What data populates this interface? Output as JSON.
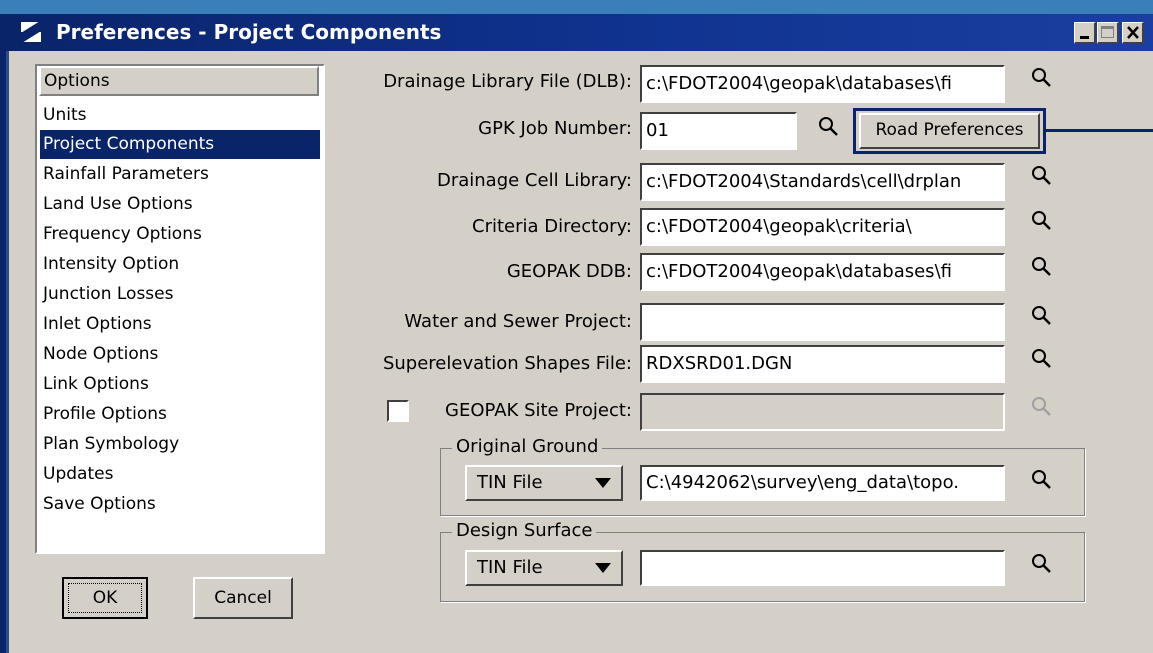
{
  "window": {
    "title": "Preferences - Project Components",
    "minimize_glyph": "_",
    "maximize_glyph": "□",
    "close_glyph": "✕"
  },
  "options_list": {
    "header": "Options",
    "items": [
      "Units",
      "Project Components",
      "Rainfall Parameters",
      "Land Use Options",
      "Frequency Options",
      "Intensity Option",
      "Junction Losses",
      "Inlet Options",
      "Node Options",
      "Link Options",
      "Profile Options",
      "Plan Symbology",
      "Updates",
      "Save Options"
    ],
    "selected": "Project Components"
  },
  "buttons": {
    "ok": "OK",
    "cancel": "Cancel",
    "road_preferences": "Road Preferences"
  },
  "fields": {
    "drainage_library": {
      "label": "Drainage Library File (DLB):",
      "value": "c:\\FDOT2004\\geopak\\databases\\fi"
    },
    "gpk_job": {
      "label": "GPK Job Number:",
      "value": "01"
    },
    "drainage_cell": {
      "label": "Drainage Cell Library:",
      "value": "c:\\FDOT2004\\Standards\\cell\\drplan"
    },
    "criteria_dir": {
      "label": "Criteria Directory:",
      "value": "c:\\FDOT2004\\geopak\\criteria\\"
    },
    "geopak_ddb": {
      "label": "GEOPAK DDB:",
      "value": "c:\\FDOT2004\\geopak\\databases\\fi"
    },
    "water_sewer": {
      "label": "Water and Sewer Project:",
      "value": ""
    },
    "superelevation": {
      "label": "Superelevation Shapes File:",
      "value": "RDXSRD01.DGN"
    },
    "site_project": {
      "label": "GEOPAK Site Project:",
      "value": "",
      "checked": false
    }
  },
  "original_ground": {
    "legend": "Original Ground",
    "type": "TIN File",
    "value": "C:\\4942062\\survey\\eng_data\\topo."
  },
  "design_surface": {
    "legend": "Design Surface",
    "type": "TIN File",
    "value": ""
  },
  "icons": {
    "browse": "magnifier-icon",
    "dropdown": "triangle-down-icon"
  }
}
